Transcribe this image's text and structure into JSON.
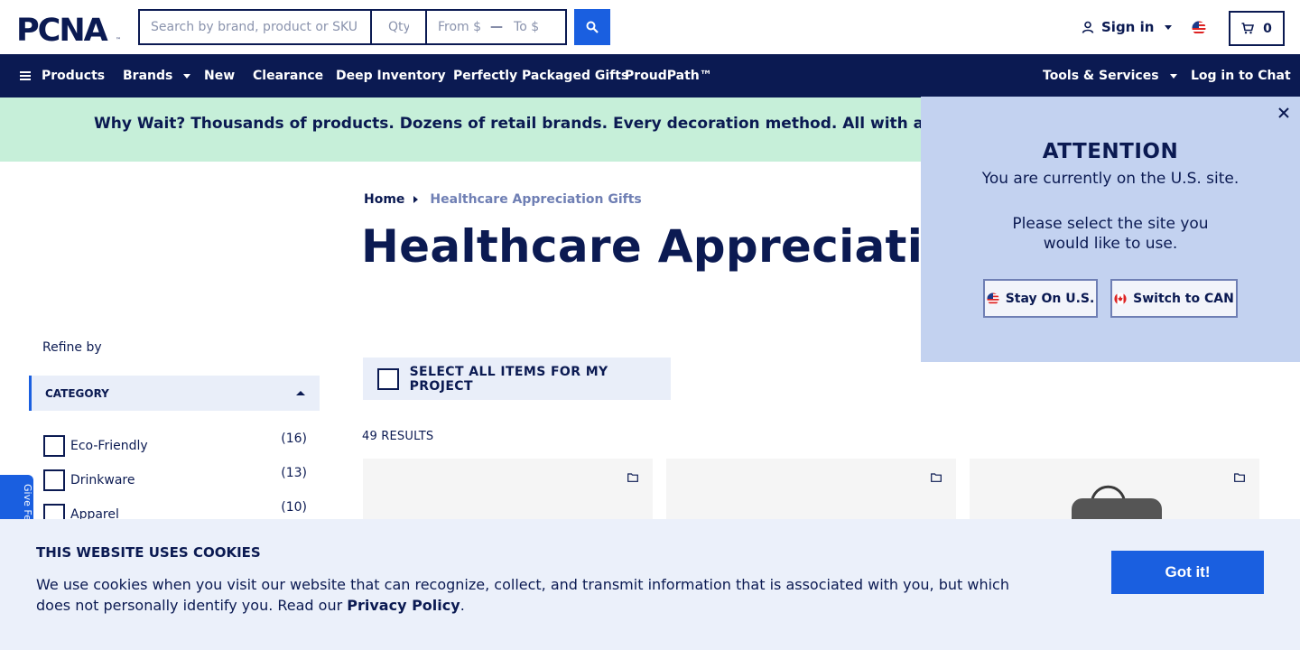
{
  "header": {
    "logo_text": "PCNA",
    "search_placeholder": "Search by brand, product or SKU",
    "qty_placeholder": "Qty",
    "price_from": "From $",
    "price_to": "To $",
    "signin_label": "Sign in",
    "cart_count": "0"
  },
  "nav": {
    "products": "Products",
    "brands": "Brands",
    "new": "New",
    "clearance": "Clearance",
    "deep_inventory": "Deep Inventory",
    "packaged_gifts": "Perfectly Packaged Gifts",
    "proudpath": "ProudPath™",
    "tools_services": "Tools & Services",
    "chat": "Log in to Chat"
  },
  "promo": {
    "text": "Why Wait? Thousands of products. Dozens of retail brands. Every decoration method. All with a standard"
  },
  "breadcrumb": {
    "home": "Home",
    "current": "Healthcare Appreciation Gifts"
  },
  "page_title": "Healthcare Appreciation Gifts",
  "sidebar": {
    "refine_label": "Refine by",
    "category_header": "CATEGORY",
    "categories": [
      {
        "label": "Eco-Friendly",
        "count": "(16)"
      },
      {
        "label": "Drinkware",
        "count": "(13)"
      },
      {
        "label": "Apparel",
        "count": "(10)"
      }
    ],
    "feedback": "Give Fe"
  },
  "results": {
    "select_all": "SELECT ALL ITEMS FOR MY PROJECT",
    "count": "49 RESULTS"
  },
  "locale_popup": {
    "title": "ATTENTION",
    "line1": "You are currently on the U.S. site.",
    "line2": "Please select the site you",
    "line3": "would like to use.",
    "stay_label": "Stay On U.S.",
    "switch_label": "Switch to CAN"
  },
  "cookie": {
    "title": "THIS WEBSITE USES COOKIES",
    "text": "We use cookies when you visit our website that can recognize, collect, and transmit information that is associated with you, but which does not personally identify you. Read our ",
    "link": "Privacy Policy",
    "period": ".",
    "button": "Got it!"
  },
  "colors": {
    "navy": "#0b1a52",
    "accent_blue": "#1a5fe0",
    "promo_green": "#c6efd9",
    "popup_blue": "#c3d2f0",
    "cookie_bg": "#ebf0fa"
  }
}
